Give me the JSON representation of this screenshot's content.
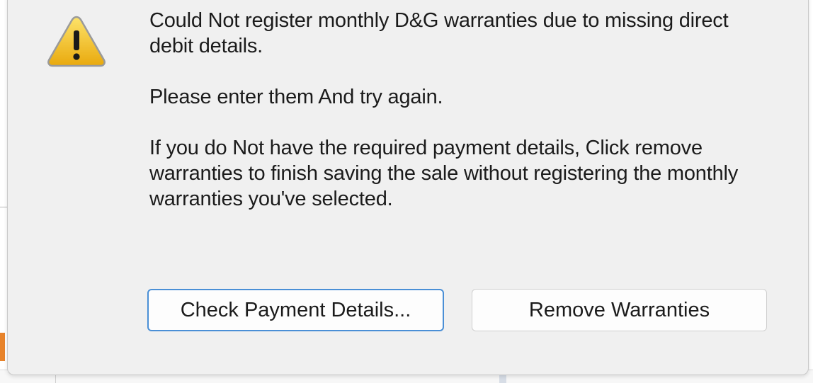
{
  "dialog": {
    "icon": "warning-icon",
    "message": {
      "line1": "Could Not register monthly D&G warranties due to missing direct debit details.",
      "line2": "Please enter them And try again.",
      "line3": "If you do Not have the required payment details, Click remove warranties to finish saving the sale without registering the monthly warranties you've selected."
    },
    "buttons": {
      "check_payment_label": "Check Payment Details...",
      "remove_warranties_label": "Remove Warranties"
    }
  },
  "colors": {
    "dialog_background": "#f0f0f0",
    "primary_button_border": "#4a8fd6",
    "warning_yellow": "#f5c518",
    "background_accent_orange": "#e8832a"
  }
}
